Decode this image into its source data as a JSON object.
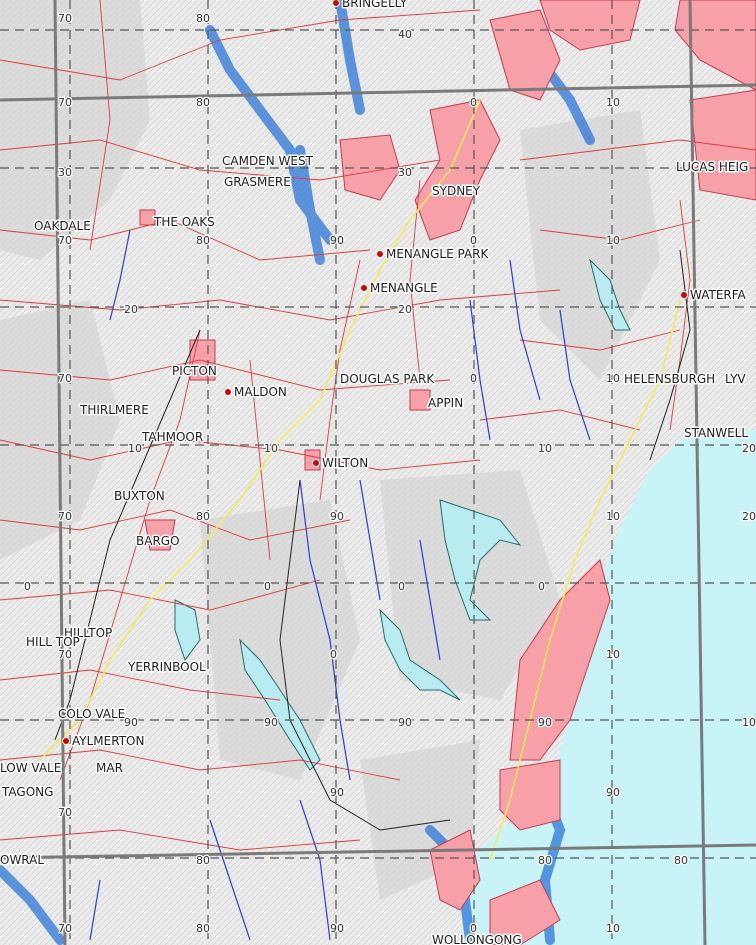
{
  "map": {
    "colors": {
      "terrain": "#e6e6e6",
      "ocean": "#c8f4f8",
      "urban": "#f7a0a8",
      "urban_edge": "#c43c50",
      "roads": "#e23a3a",
      "rivers": "#2a3fd6",
      "flood": "#1f6ed8",
      "reservoir": "#b8ecf0",
      "railway": "#222222",
      "highway": "#f5ea5a",
      "grid_major": "#7a7a7a",
      "grid_minor": "#555555",
      "town_marker": "#d40000"
    },
    "places": [
      {
        "name": "BRINGELLY",
        "marker": true
      },
      {
        "name": "CAMDEN WEST"
      },
      {
        "name": "GRASMERE"
      },
      {
        "name": "SYDNEY"
      },
      {
        "name": "LUCAS HEIG"
      },
      {
        "name": "OAKDALE"
      },
      {
        "name": "THE OAKS"
      },
      {
        "name": "MENANGLE PARK",
        "marker": true
      },
      {
        "name": "MENANGLE",
        "marker": true
      },
      {
        "name": "WATERFA",
        "marker": true
      },
      {
        "name": "PICTON"
      },
      {
        "name": "MALDON",
        "marker": true
      },
      {
        "name": "DOUGLAS PARK"
      },
      {
        "name": "APPIN"
      },
      {
        "name": "HELENSBURGH"
      },
      {
        "name": "LYV"
      },
      {
        "name": "THIRLMERE"
      },
      {
        "name": "TAHMOOR"
      },
      {
        "name": "STANWELL"
      },
      {
        "name": "WILTON",
        "marker": true
      },
      {
        "name": "BUXTON"
      },
      {
        "name": "BARGO"
      },
      {
        "name": "HILLTOP"
      },
      {
        "name": "HILL TOP"
      },
      {
        "name": "YERRINBOOL"
      },
      {
        "name": "COLO VALE"
      },
      {
        "name": "AYLMERTON",
        "marker": true
      },
      {
        "name": "LOW VALE"
      },
      {
        "name": "MAR"
      },
      {
        "name": "TAGONG"
      },
      {
        "name": "OWRAL"
      },
      {
        "name": "WOLLONGONG"
      }
    ],
    "grid_labels": [
      "70",
      "80",
      "40",
      "70",
      "80",
      "0",
      "10",
      "30",
      "30",
      "70",
      "80",
      "90",
      "0",
      "10",
      "20",
      "20",
      "70",
      "0",
      "10",
      "10",
      "10",
      "10",
      "20",
      "70",
      "80",
      "90",
      "10",
      "20",
      "0",
      "0",
      "0",
      "0",
      "70",
      "0",
      "10",
      "90",
      "90",
      "90",
      "90",
      "10",
      "90",
      "70",
      "90",
      "80",
      "80",
      "80",
      "70",
      "80",
      "90",
      "0",
      "10"
    ]
  }
}
